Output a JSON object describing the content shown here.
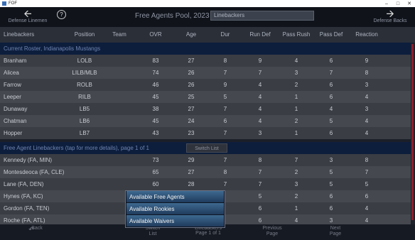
{
  "window": {
    "title": "FOF"
  },
  "header": {
    "left_nav": "Defense Linemen",
    "right_nav": "Defense Backs",
    "title": "Free Agents Pool, 2023",
    "position_select": "Linebackers"
  },
  "columns": [
    "Linebackers",
    "Position",
    "Team",
    "OVR",
    "Age",
    "Dur",
    "Run Def",
    "Pass Rush",
    "Pass Def",
    "Reaction"
  ],
  "roster_header": "Current Roster, Indianapolis Mustangs",
  "roster": [
    {
      "name": "Branham",
      "pos": "LOLB",
      "team": "",
      "ovr": "83",
      "age": "27",
      "dur": "8",
      "run": "9",
      "rush": "4",
      "pdef": "6",
      "rea": "9"
    },
    {
      "name": "Alicea",
      "pos": "LILB/MLB",
      "team": "",
      "ovr": "74",
      "age": "26",
      "dur": "7",
      "run": "7",
      "rush": "3",
      "pdef": "7",
      "rea": "8"
    },
    {
      "name": "Farrow",
      "pos": "ROLB",
      "team": "",
      "ovr": "46",
      "age": "26",
      "dur": "9",
      "run": "4",
      "rush": "2",
      "pdef": "6",
      "rea": "3"
    },
    {
      "name": "Leeper",
      "pos": "RILB",
      "team": "",
      "ovr": "45",
      "age": "25",
      "dur": "5",
      "run": "4",
      "rush": "1",
      "pdef": "6",
      "rea": "4"
    },
    {
      "name": "Dunaway",
      "pos": "LB5",
      "team": "",
      "ovr": "38",
      "age": "27",
      "dur": "7",
      "run": "4",
      "rush": "1",
      "pdef": "4",
      "rea": "3"
    },
    {
      "name": "Chatman",
      "pos": "LB6",
      "team": "",
      "ovr": "45",
      "age": "24",
      "dur": "6",
      "run": "4",
      "rush": "2",
      "pdef": "5",
      "rea": "4"
    },
    {
      "name": "Hopper",
      "pos": "LB7",
      "team": "",
      "ovr": "43",
      "age": "23",
      "dur": "7",
      "run": "3",
      "rush": "1",
      "pdef": "6",
      "rea": "4"
    }
  ],
  "fa_header": "Free Agent Linebackers (tap for more details), page 1 of 1",
  "switch_list": "Switch List",
  "free_agents": [
    {
      "name": "Kennedy (FA, MIN)",
      "pos": "",
      "team": "",
      "ovr": "73",
      "age": "29",
      "dur": "7",
      "run": "8",
      "rush": "7",
      "pdef": "3",
      "rea": "8"
    },
    {
      "name": "Montesdeoca (FA, CLE)",
      "pos": "",
      "team": "",
      "ovr": "65",
      "age": "27",
      "dur": "8",
      "run": "7",
      "rush": "2",
      "pdef": "5",
      "rea": "7"
    },
    {
      "name": "Lane (FA, DEN)",
      "pos": "",
      "team": "",
      "ovr": "60",
      "age": "28",
      "dur": "7",
      "run": "7",
      "rush": "3",
      "pdef": "5",
      "rea": "5"
    },
    {
      "name": "Hynes (FA, KC)",
      "pos": "",
      "team": "",
      "ovr": "",
      "age": "",
      "dur": "",
      "run": "5",
      "rush": "2",
      "pdef": "6",
      "rea": "6"
    },
    {
      "name": "Gordon (FA, TEN)",
      "pos": "",
      "team": "",
      "ovr": "",
      "age": "",
      "dur": "",
      "run": "6",
      "rush": "1",
      "pdef": "6",
      "rea": "4"
    },
    {
      "name": "Roche (FA, ATL)",
      "pos": "",
      "team": "",
      "ovr": "",
      "age": "",
      "dur": "",
      "run": "6",
      "rush": "4",
      "pdef": "3",
      "rea": "4"
    }
  ],
  "popup": {
    "options": [
      "Available Free Agents",
      "Available Rookies",
      "Available Waivers"
    ]
  },
  "footer": {
    "back": "Back",
    "switch_list": "Switch List",
    "linebackers": "Linebackers",
    "page": "Page 1 of 1",
    "prev_page": "Previous Page",
    "next_page": "Next Page"
  }
}
